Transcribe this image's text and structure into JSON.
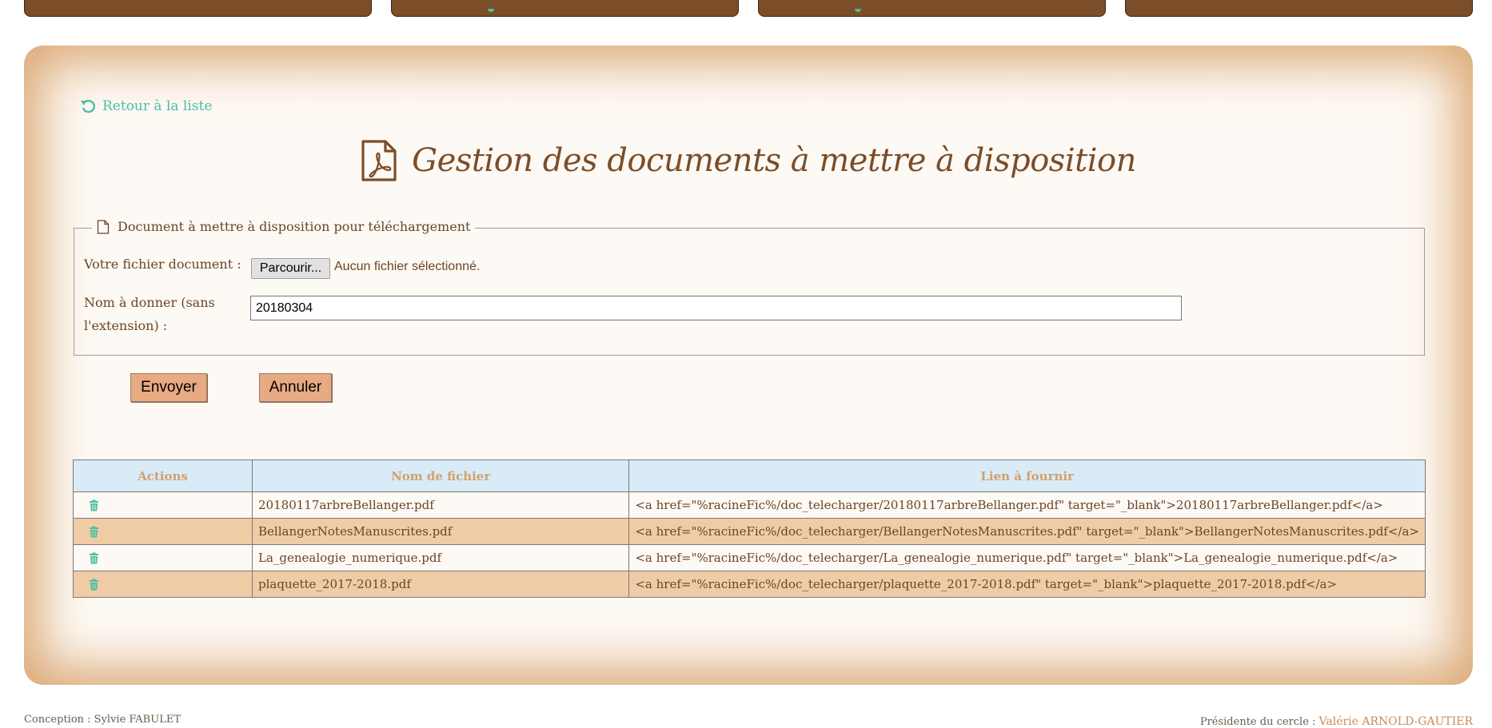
{
  "colors": {
    "brand_brown": "#7b4d28",
    "accent_teal": "#49bfa2",
    "panel_glow": "#dcab79",
    "button_bg": "#e8aa82",
    "table_header_bg": "#d8ebf7",
    "row_alt_bg": "#f0cca6"
  },
  "nav": {
    "tabs": [
      {
        "label": "",
        "icon": ""
      },
      {
        "label": "",
        "icon": "teal-marker"
      },
      {
        "label": "",
        "icon": "teal-marker"
      },
      {
        "label": "",
        "icon": ""
      }
    ]
  },
  "back_link": {
    "label": "Retour à la liste",
    "icon": "undo-arrow-icon"
  },
  "page": {
    "title": "Gestion des documents à mettre à disposition",
    "icon": "pdf-file-icon"
  },
  "form": {
    "legend": "Document à mettre à disposition pour téléchargement",
    "file_label": "Votre fichier document :",
    "file_button": "Parcourir...",
    "file_status": "Aucun fichier sélectionné.",
    "name_label_line1": "Nom à donner (sans",
    "name_label_line2": "l'extension) :",
    "name_value": "20180304",
    "submit_label": "Envoyer",
    "cancel_label": "Annuler"
  },
  "table": {
    "headers": [
      "Actions",
      "Nom de fichier",
      "Lien à fournir"
    ],
    "rows": [
      {
        "action_icon": "trash-icon",
        "filename": "20180117arbreBellanger.pdf",
        "link": "<a href=\"%racineFic%/doc_telecharger/20180117arbreBellanger.pdf\" target=\"_blank\">20180117arbreBellanger.pdf</a>"
      },
      {
        "action_icon": "trash-icon",
        "filename": "BellangerNotesManuscrites.pdf",
        "link": "<a href=\"%racineFic%/doc_telecharger/BellangerNotesManuscrites.pdf\" target=\"_blank\">BellangerNotesManuscrites.pdf</a>"
      },
      {
        "action_icon": "trash-icon",
        "filename": "La_genealogie_numerique.pdf",
        "link": "<a href=\"%racineFic%/doc_telecharger/La_genealogie_numerique.pdf\" target=\"_blank\">La_genealogie_numerique.pdf</a>"
      },
      {
        "action_icon": "trash-icon",
        "filename": "plaquette_2017-2018.pdf",
        "link": "<a href=\"%racineFic%/doc_telecharger/plaquette_2017-2018.pdf\" target=\"_blank\">plaquette_2017-2018.pdf</a>"
      }
    ]
  },
  "footer": {
    "left": "Conception : Sylvie FABULET",
    "right_prefix": "Présidente du cercle : ",
    "right_name": "Valérie ARNOLD-GAUTIER"
  }
}
